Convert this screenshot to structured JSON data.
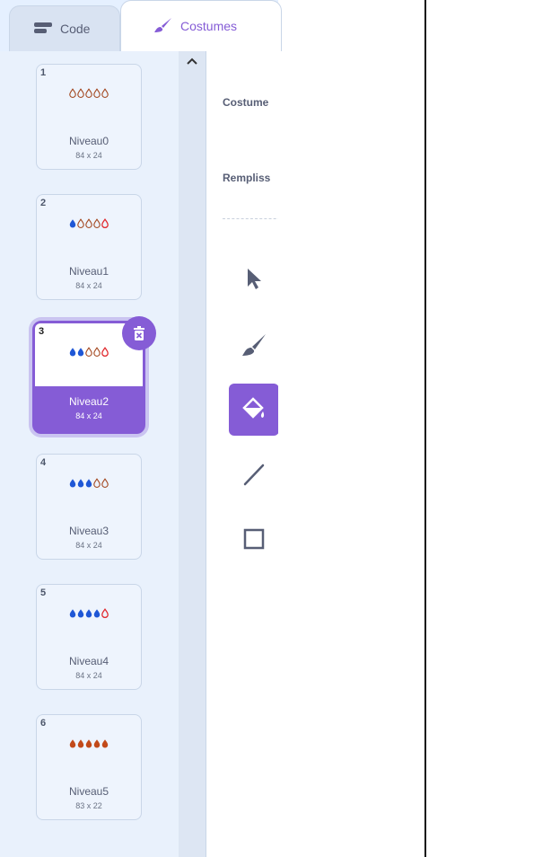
{
  "tabs": [
    {
      "label": "Code",
      "icon": "code-blocks-icon"
    },
    {
      "label": "Costumes",
      "icon": "paintbrush-icon",
      "active": true
    }
  ],
  "costumes": [
    {
      "number": "1",
      "name": "Niveau0",
      "size": "84 x 24",
      "drops": [
        "empty",
        "empty",
        "empty",
        "empty",
        "empty"
      ]
    },
    {
      "number": "2",
      "name": "Niveau1",
      "size": "84 x 24",
      "drops": [
        "blue",
        "empty",
        "empty",
        "empty",
        "red-outline"
      ]
    },
    {
      "number": "3",
      "name": "Niveau2",
      "size": "84 x 24",
      "drops": [
        "blue",
        "blue",
        "empty",
        "empty",
        "red-outline"
      ],
      "selected": true
    },
    {
      "number": "4",
      "name": "Niveau3",
      "size": "84 x 24",
      "drops": [
        "blue",
        "blue",
        "blue",
        "empty",
        "empty"
      ]
    },
    {
      "number": "5",
      "name": "Niveau4",
      "size": "84 x 24",
      "drops": [
        "blue",
        "blue",
        "blue",
        "blue",
        "red-outline"
      ]
    },
    {
      "number": "6",
      "name": "Niveau5",
      "size": "83 x 22",
      "drops": [
        "orange",
        "orange",
        "orange",
        "orange",
        "orange"
      ]
    }
  ],
  "editor": {
    "costume_label": "Costume",
    "fill_label": "Rempliss",
    "tools": [
      "select-tool-icon",
      "brush-tool-icon",
      "fill-tool-icon",
      "line-tool-icon",
      "rectangle-tool-icon"
    ],
    "active_tool": "fill-tool-icon"
  },
  "colors": {
    "accent": "#855cd6",
    "drop_blue": "#1f57d6",
    "drop_red": "#e0262b",
    "drop_orange": "#c24a1a",
    "drop_outline": "#a3471f"
  }
}
